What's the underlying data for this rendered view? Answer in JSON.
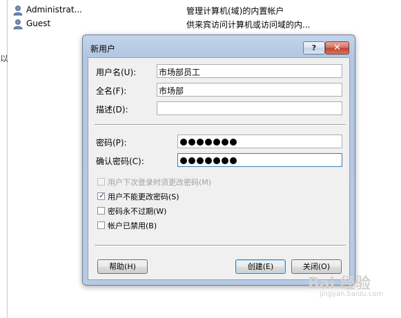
{
  "background": {
    "left_char": "以",
    "rows": [
      {
        "name": "Administrat...",
        "description": "管理计算机(域)的内置帐户"
      },
      {
        "name": "Guest",
        "description": "供来宾访问计算机或访问域的内..."
      }
    ]
  },
  "dialog": {
    "title": "新用户",
    "help_button": "?",
    "close_button": "✕",
    "fields": {
      "username_label": "用户名(U):",
      "username_value": "市场部员工",
      "fullname_label": "全名(F):",
      "fullname_value": "市场部",
      "description_label": "描述(D):",
      "description_value": "",
      "password_label": "密码(P):",
      "confirm_label": "确认密码(C):"
    },
    "password_dot_count": 7,
    "checkboxes": [
      {
        "label": "用户下次登录时须更改密码(M)",
        "checked": false,
        "disabled": true
      },
      {
        "label": "用户不能更改密码(S)",
        "checked": true,
        "disabled": false
      },
      {
        "label": "密码永不过期(W)",
        "checked": false,
        "disabled": false
      },
      {
        "label": "帐户已禁用(B)",
        "checked": false,
        "disabled": false
      }
    ],
    "buttons": {
      "help": "帮助(H)",
      "create": "创建(E)",
      "close": "关闭(O)"
    }
  },
  "watermark": {
    "text": "Bai 经验",
    "url": "jingyan.baidu.com"
  }
}
